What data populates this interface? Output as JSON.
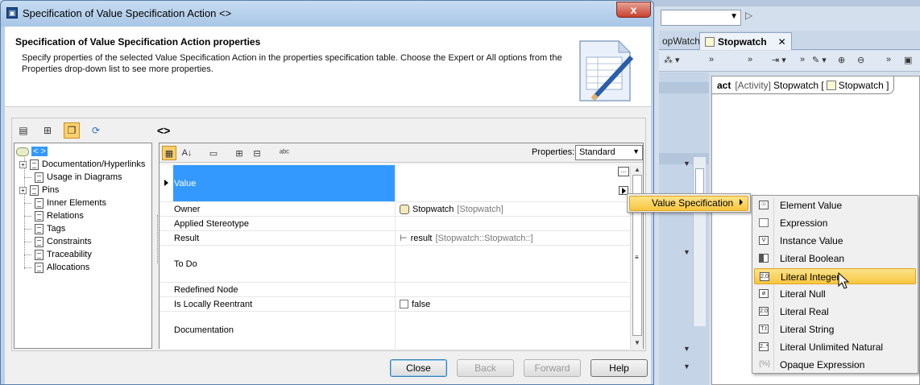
{
  "dialog": {
    "title": "Specification of Value Specification Action <>",
    "close_glyph": "x",
    "header_title": "Specification of Value Specification Action properties",
    "header_description": "Specify properties of the selected Value Specification Action in the properties specification table. Choose the Expert or All options from the Properties drop-down list to see more properties.",
    "element_name": "<>"
  },
  "tree": {
    "root_label": "< >",
    "items": [
      {
        "label": "Documentation/Hyperlinks",
        "expandable": true
      },
      {
        "label": "Usage in Diagrams",
        "expandable": false
      },
      {
        "label": "Pins",
        "expandable": true
      },
      {
        "label": "Inner Elements",
        "expandable": false
      },
      {
        "label": "Relations",
        "expandable": false
      },
      {
        "label": "Tags",
        "expandable": false
      },
      {
        "label": "Constraints",
        "expandable": false
      },
      {
        "label": "Traceability",
        "expandable": false
      },
      {
        "label": "Allocations",
        "expandable": false
      }
    ]
  },
  "properties": {
    "label": "Properties:",
    "selected": "Standard"
  },
  "table": {
    "rows": [
      {
        "name": "Value",
        "value": "",
        "value_gray": ""
      },
      {
        "name": "Owner",
        "value": "Stopwatch",
        "value_gray": "[Stopwatch]"
      },
      {
        "name": "Applied Stereotype",
        "value": "",
        "value_gray": ""
      },
      {
        "name": "Result",
        "value": "result",
        "value_gray": "[Stopwatch::Stopwatch::]"
      },
      {
        "name": "To Do",
        "value": "",
        "value_gray": ""
      },
      {
        "name": "Redefined Node",
        "value": "",
        "value_gray": ""
      },
      {
        "name": "Is Locally Reentrant",
        "value": "false",
        "value_gray": ""
      },
      {
        "name": "Documentation",
        "value": "",
        "value_gray": ""
      }
    ],
    "dots_label": "..."
  },
  "buttons": {
    "close": "Close",
    "back": "Back",
    "forward": "Forward",
    "help": "Help"
  },
  "menu": {
    "parent": "Value Specification",
    "items": [
      {
        "label": "Element Value",
        "icon": "element-value-icon",
        "glyph": "☉"
      },
      {
        "label": "Expression",
        "icon": "expression-icon",
        "glyph": ""
      },
      {
        "label": "Instance Value",
        "icon": "instance-value-icon",
        "glyph": "V"
      },
      {
        "label": "Literal Boolean",
        "icon": "literal-boolean-icon",
        "glyph": ""
      },
      {
        "label": "Literal Integer",
        "icon": "literal-integer-icon",
        "glyph": "2,0"
      },
      {
        "label": "Literal Null",
        "icon": "literal-null-icon",
        "glyph": "ø"
      },
      {
        "label": "Literal Real",
        "icon": "literal-real-icon",
        "glyph": "2.0"
      },
      {
        "label": "Literal String",
        "icon": "literal-string-icon",
        "glyph": "T.t"
      },
      {
        "label": "Literal Unlimited Natural",
        "icon": "literal-unlimited-natural-icon",
        "glyph": "2..*"
      },
      {
        "label": "Opaque Expression",
        "icon": "opaque-expression-icon",
        "glyph": "{%}"
      }
    ],
    "highlighted_index": 4
  },
  "background": {
    "tab_partial": "opWatch",
    "tab_active": "Stopwatch",
    "tab_close": "✕",
    "diagram_kind": "act",
    "diagram_type": "[Activity]",
    "diagram_name": "Stopwatch [",
    "diagram_owner": "Stopwatch ]"
  }
}
